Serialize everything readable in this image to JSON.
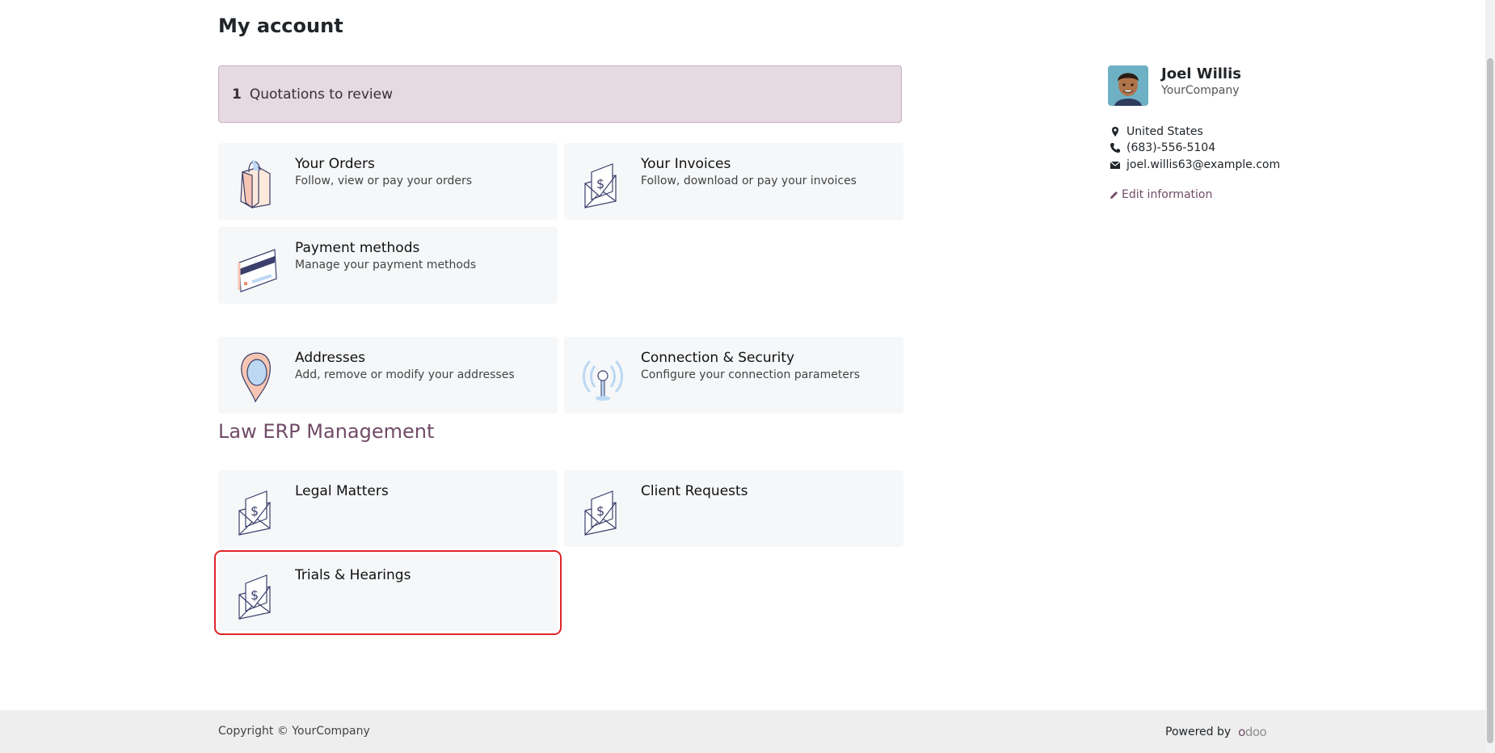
{
  "page_title": "My account",
  "alert": {
    "count": "1",
    "label": "Quotations to review"
  },
  "cards": [
    {
      "title": "Your Orders",
      "subtitle": "Follow, view or pay your orders",
      "icon": "shopping-bag-icon"
    },
    {
      "title": "Your Invoices",
      "subtitle": "Follow, download or pay your invoices",
      "icon": "invoice-envelope-icon"
    },
    {
      "title": "Payment methods",
      "subtitle": "Manage your payment methods",
      "icon": "credit-card-icon"
    },
    {
      "title": "Addresses",
      "subtitle": "Add, remove or modify your addresses",
      "icon": "map-pin-icon"
    },
    {
      "title": "Connection & Security",
      "subtitle": "Configure your connection parameters",
      "icon": "antenna-icon"
    }
  ],
  "section": {
    "title": "Law ERP Management",
    "cards": [
      {
        "title": "Legal Matters",
        "icon": "invoice-envelope-icon"
      },
      {
        "title": "Client Requests",
        "icon": "invoice-envelope-icon"
      },
      {
        "title": "Trials & Hearings",
        "icon": "invoice-envelope-icon",
        "highlighted": true
      }
    ]
  },
  "profile": {
    "name": "Joel Willis",
    "company": "YourCompany",
    "country": "United States",
    "phone": "(683)-556-5104",
    "email": "joel.willis63@example.com",
    "edit_label": "Edit information"
  },
  "footer": {
    "copyright": "Copyright © YourCompany",
    "powered_by": "Powered by",
    "logo_text": "odoo"
  },
  "colors": {
    "accent": "#714b67",
    "alert_bg": "#e6dae2",
    "card_bg": "#f5f7f9",
    "highlight": "#e0252b"
  }
}
